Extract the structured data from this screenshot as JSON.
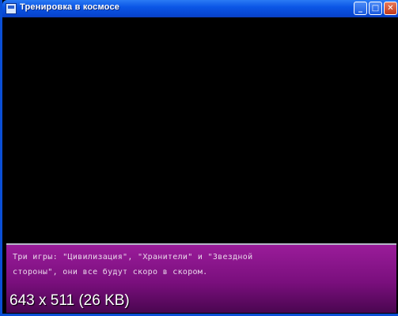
{
  "window": {
    "title": "Тренировка в космосе",
    "controls": {
      "minimize": "_",
      "maximize": "□",
      "close": "✕"
    }
  },
  "dialog": {
    "line1": "Три игры: \"Цивилизация\", \"Хранители\" и \"Звездной",
    "line2": "стороны\", они все будут скоро в скором."
  },
  "caption": "643 x 511 (26 KB)"
}
